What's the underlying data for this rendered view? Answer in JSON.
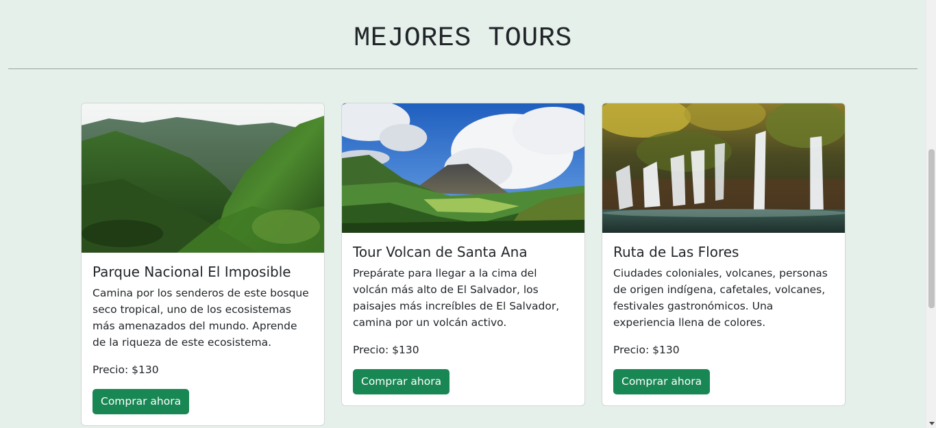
{
  "header": {
    "title": "MEJORES TOURS"
  },
  "cards": [
    {
      "image_alt": "mountain-forest-photo",
      "title": "Parque Nacional El Imposible",
      "description": "Camina por los senderos de este bosque seco tropical, uno de los ecosistemas más amenazados del mundo. Aprende de la riqueza de este ecosistema.",
      "price": "Precio: $130",
      "button_label": "Comprar ahora"
    },
    {
      "image_alt": "volcano-photo",
      "title": "Tour Volcan de Santa Ana",
      "description": "Prepárate para llegar a la cima del volcán más alto de El Salvador, los paisajes más increíbles de El Salvador, camina por un volcán activo.",
      "price": "Precio: $130",
      "button_label": "Comprar ahora"
    },
    {
      "image_alt": "waterfall-photo",
      "title": "Ruta de Las Flores",
      "description": "Ciudades coloniales, volcanes, personas de origen indígena, cafetales, volcanes, festivales gastronómicos. Una experiencia llena de colores.",
      "price": "Precio: $130",
      "button_label": "Comprar ahora"
    }
  ],
  "colors": {
    "background": "#e6f0ea",
    "button": "#198754",
    "card": "#ffffff"
  }
}
